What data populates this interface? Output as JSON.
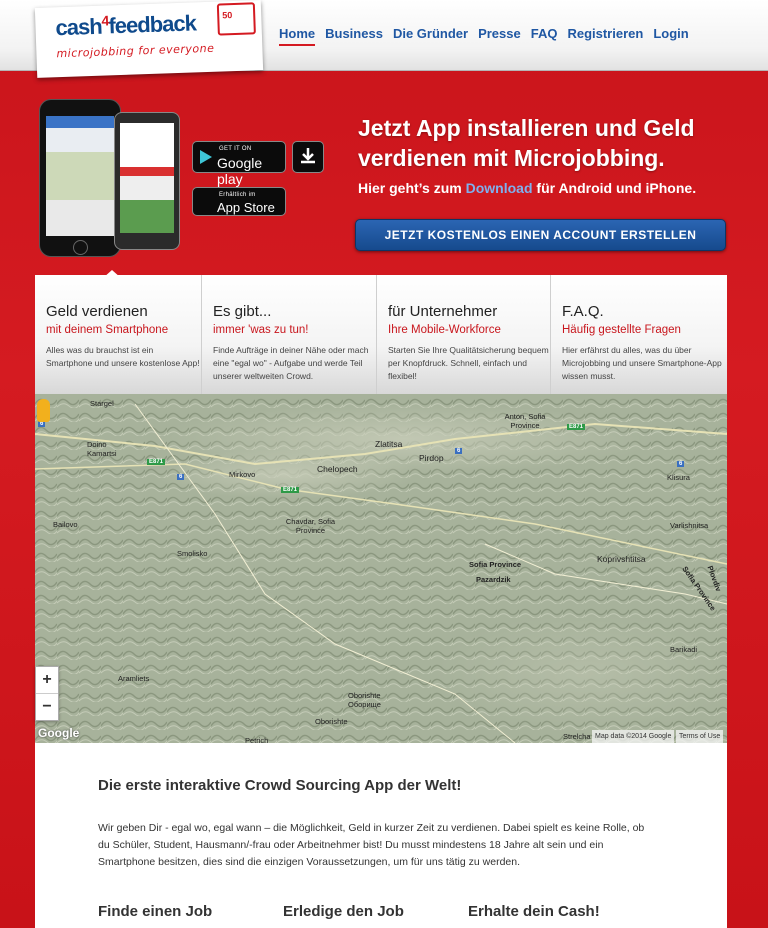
{
  "header": {
    "logo_brand_a": "cash",
    "logo_brand_num": "4",
    "logo_brand_b": "feedback",
    "logo_tagline": "microjobbing for everyone",
    "logo_badge": "50",
    "nav": [
      {
        "label": "Home",
        "active": true
      },
      {
        "label": "Business"
      },
      {
        "label": "Die Gründer"
      },
      {
        "label": "Presse"
      },
      {
        "label": "FAQ"
      },
      {
        "label": "Registrieren"
      },
      {
        "label": "Login"
      }
    ]
  },
  "hero": {
    "title_line1": "Jetzt App installieren und Geld",
    "title_line2": "verdienen mit Microjobbing.",
    "sub_prefix": "Hier geht’s zum ",
    "sub_link": "Download",
    "sub_suffix": " für Android und iPhone.",
    "google_play_small": "GET IT ON",
    "google_play_big": "Google play",
    "app_store_small": "Erhältlich im",
    "app_store_big": "App Store",
    "cta": "JETZT KOSTENLOS EINEN ACCOUNT ERSTELLEN"
  },
  "panel": [
    {
      "title": "Geld verdienen",
      "subtitle": "mit deinem Smartphone",
      "text": "Alles was du brauchst ist ein Smartphone und unsere kostenlose App!"
    },
    {
      "title": "Es gibt...",
      "subtitle": "immer 'was zu tun!",
      "text": "Finde Aufträge in deiner Nähe oder mach eine \"egal wo\" - Aufgabe und werde Teil unserer weltweiten Crowd."
    },
    {
      "title": "für Unternehmer",
      "subtitle": "Ihre Mobile-Workforce",
      "text": "Starten Sie Ihre Qualitätsicherung bequem per Knopfdruck. Schnell, einfach und flexibel!"
    },
    {
      "title": "F.A.Q.",
      "subtitle": "Häufig gestellte Fragen",
      "text": "Hier erfährst du alles, was du über Microjobbing und unsere Smartphone-App wissen musst."
    }
  ],
  "map": {
    "places": [
      "Stargel",
      "Anton, Sofia Province",
      "Zlatitsa",
      "Pirdop",
      "Doino Kamartsi",
      "Chelopech",
      "Mirkovo",
      "Klisura",
      "Varlishnitsa",
      "Bailovo",
      "Chavdar, Sofia Province",
      "Smolisko",
      "Sofia Province",
      "Pazardzik",
      "Koprivshtitsa",
      "Plovdiv",
      "Sofia Province",
      "Barikadi",
      "Aramliets",
      "Oborishte",
      "Оборище",
      "Oborishte",
      "Petrich",
      "Strelcha"
    ],
    "roads": [
      "6",
      "E871",
      "6",
      "E871",
      "6",
      "E871",
      "6"
    ],
    "zoom_in": "+",
    "zoom_out": "−",
    "attribution": "Map data ©2014 Google",
    "terms": "Terms of Use",
    "google": "Google"
  },
  "content": {
    "heading": "Die erste  interaktive Crowd Sourcing App der Welt!",
    "body": "Wir geben Dir - egal wo, egal wann – die Möglichkeit, Geld in kurzer Zeit zu verdienen. Dabei spielt es keine Rolle, ob du Schüler, Student, Hausmann/-frau oder Arbeitnehmer bist! Du musst mindestens 18 Jahre alt sein und ein Smartphone besitzen, dies sind die einzigen Voraussetzungen, um für uns tätig zu werden.",
    "steps": [
      "Finde einen Job",
      "Erledige den Job",
      "Erhalte dein Cash!"
    ]
  }
}
